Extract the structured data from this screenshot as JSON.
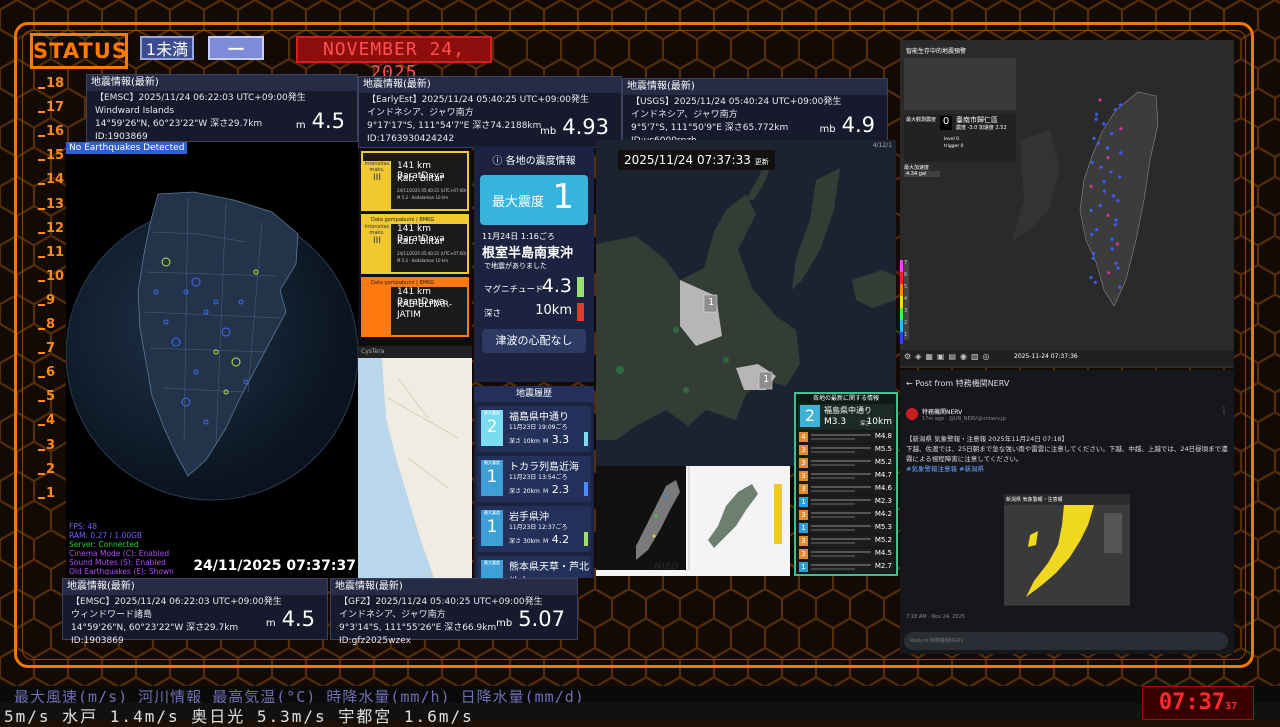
{
  "header": {
    "status_label": "STATUS",
    "intensity_pill": "1未満",
    "dash_pill": "一",
    "date_text": "NOVEMBER 24, 2025"
  },
  "scale": [
    "18",
    "17",
    "16",
    "15",
    "14",
    "13",
    "12",
    "11",
    "10",
    "9",
    "8",
    "7",
    "6",
    "5",
    "4",
    "3",
    "2",
    "1"
  ],
  "cards": {
    "emsc_top": {
      "head": "地震情報(最新)",
      "l1": "【EMSC】2025/11/24  06:22:03  UTC+09:00発生",
      "l2": "Windward Islands",
      "l3": "14°59'26\"N,  60°23'22\"W   深さ29.7km",
      "l4": "ID:1903869",
      "mtype": "m",
      "mag": "4.5"
    },
    "earlyest": {
      "head": "地震情報(最新)",
      "l1": "【EarlyEst】2025/11/24  05:40:25  UTC+09:00発生",
      "l2": "インドネシア、ジャワ南方",
      "l3": "9°17'17\"S,  111°54'7\"E   深さ74.2188km",
      "l4": "ID:1763930424242",
      "mtype": "mb",
      "mag": "4.93"
    },
    "usgs": {
      "head": "地震情報(最新)",
      "l1": "【USGS】2025/11/24  05:40:24  UTC+09:00発生",
      "l2": "インドネシア、ジャワ南方",
      "l3": "9°5'7\"S,  111°50'9\"E   深さ65.772km",
      "l4": "ID:us6000rpzh",
      "mtype": "mb",
      "mag": "4.9"
    },
    "emsc_bottom": {
      "head": "地震情報(最新)",
      "l1": "【EMSC】2025/11/24  06:22:03  UTC+09:00発生",
      "l2": "ウィンドワード諸島",
      "l3": "14°59'26\"N,  60°23'22\"W   深さ29.7km",
      "l4": "ID:1903869",
      "mtype": "m",
      "mag": "4.5"
    },
    "gfz": {
      "head": "地震情報(最新)",
      "l1": "【GFZ】2025/11/24  05:40:25  UTC+09:00発生",
      "l2": "インドネシア、ジャワ南方",
      "l3": "9°3'14\"S,  111°55'26\"E   深さ66.9km",
      "l4": "ID:gfz2025wzex",
      "mtype": "mb",
      "mag": "5.07"
    }
  },
  "globe": {
    "banner": "No Earthquakes Detected",
    "timestamp": "24/11/2025 07:37:37",
    "stats": [
      {
        "text": "FPS: 48",
        "color": "#7a5cff"
      },
      {
        "text": "RAM: 0.27 / 1.00GB",
        "color": "#7a5cff"
      },
      {
        "text": "Server: Connected",
        "color": "#27d02f"
      },
      {
        "text": "Cinema Mode (C): Enabled",
        "color": "#b04cff"
      },
      {
        "text": "Sound Mutes (S): Enabled",
        "color": "#b04cff"
      },
      {
        "text": "Old Earthquakes (E): Shown",
        "color": "#b04cff"
      }
    ]
  },
  "bmkg": [
    {
      "head": "",
      "intensity_label": "Intensitas maks.",
      "intensity": "III",
      "dist": "141 km BaratDaya",
      "place": "Kab. Blitar",
      "time": "24/11/2025 05:40:21 (UTC+07:00)",
      "mag": "M 5.2 · Kedalaman 10 km",
      "color": "#f0c830"
    },
    {
      "head": "Data gempabumi | BMKG",
      "intensity_label": "Intensitas maks.",
      "intensity": "III",
      "dist": "141 km BaratDaya",
      "place": "Kab. Blitar",
      "time": "24/11/2025 05:40:21 (UTC+07:00)",
      "mag": "M 5.2 · Kedalaman 10 km",
      "color": "#f0c830"
    },
    {
      "head": "Data gempabumi | BMKG",
      "intensity_label": "",
      "intensity": "",
      "dist": "141 km BaratDaya",
      "place": "KAB-BLITAR-JATIM",
      "time": "",
      "mag": "",
      "color": "#ff7a10"
    }
  ],
  "cystera_label": "CysTera",
  "shindo": {
    "title": "各地の震度情報",
    "max_label": "最大震度",
    "max_value": "1",
    "time": "11月24日 1:16ごろ",
    "epicenter": "根室半島南東沖",
    "occurred": "で地震がありました",
    "mag_label": "マグニチュード",
    "mag_value": "4.3",
    "depth_label": "深さ",
    "depth_value": "10km",
    "tsunami": "津波の心配なし"
  },
  "history": {
    "title": "地震履歴",
    "max_label": "最大震度",
    "items": [
      {
        "intensity": "2",
        "place": "福島県中通り",
        "time": "11月23日 19:09ごろ",
        "depth": "10km",
        "mag": "3.3",
        "bar": "#7bdcf0"
      },
      {
        "intensity": "1",
        "place": "トカラ列島近海",
        "time": "11月23日 13:54ごろ",
        "depth": "20km",
        "mag": "2.3",
        "bar": "#4f8bff"
      },
      {
        "intensity": "1",
        "place": "岩手県沖",
        "time": "11月23日 12:37ごろ",
        "depth": "30km",
        "mag": "4.2",
        "bar": "#9be070"
      },
      {
        "intensity": "",
        "place": "熊本県天草・芦北地方",
        "time": "",
        "depth": "",
        "mag": "",
        "bar": "#9be070"
      }
    ],
    "depth_label": "深さ",
    "m_label": "M"
  },
  "map": {
    "time": "2025/11/24  07:37:33",
    "suffix": "更新",
    "marker1": "1",
    "marker2": "1",
    "zoom": "4/12/1"
  },
  "nied_label": "NIED",
  "intensity_list": {
    "title": "各地の最新に関する情報",
    "head_int": "2",
    "head_place": "福島県中通り",
    "head_mag": "M3.3",
    "head_depth": "10km",
    "head_depth_label": "深さ",
    "rows": [
      {
        "i": "4",
        "c": "#e38a2c",
        "m": "M4.8"
      },
      {
        "i": "3",
        "c": "#e38a2c",
        "m": "M5.5"
      },
      {
        "i": "3",
        "c": "#e38a2c",
        "m": "M5.2"
      },
      {
        "i": "3",
        "c": "#e38a2c",
        "m": "M4.7"
      },
      {
        "i": "3",
        "c": "#e38a2c",
        "m": "M4.6"
      },
      {
        "i": "1",
        "c": "#2aa0d8",
        "m": "M2.3"
      },
      {
        "i": "3",
        "c": "#e38a2c",
        "m": "M4.2"
      },
      {
        "i": "1",
        "c": "#2aa0d8",
        "m": "M5.3"
      },
      {
        "i": "3",
        "c": "#e38a2c",
        "m": "M5.2"
      },
      {
        "i": "3",
        "c": "#e38a2c",
        "m": "M4.5"
      },
      {
        "i": "1",
        "c": "#2aa0d8",
        "m": "M2.7"
      }
    ]
  },
  "taiwan": {
    "title": "智能生存中的地震預警",
    "max_label": "最大觀測震度",
    "max_value": "0",
    "station": "臺南市歸仁區",
    "station_stats": "震度 -3.0  加速度 2.52",
    "level_label": "level",
    "trigger_label": "trigger",
    "level_value": "0",
    "trigger_value": "0",
    "pga_label": "最大加速度",
    "pga_value": "4.34 gal",
    "timestamp": "2025-11-24 07:37:36",
    "scale": [
      "7",
      "6",
      "5",
      "4",
      "3",
      "2",
      "1"
    ]
  },
  "post": {
    "back_label": "Post from 特務機関NERV",
    "author": "特務機関NERV",
    "meta": "17m ago · @UN_NERV@unnerv.jp",
    "heading": "【新潟県 気象警報・注意報 2025年11月24日 07:18】",
    "body": "下越、佐渡では、25日朝まで急な強い雨や雷雲に注意してください。下越、中越、上越では、24日昼頃まで濃霧による視程障害に注意してください。",
    "tags": "#気象警報注意報 #新潟県",
    "map_caption": "新潟県 気象警報・注意報",
    "footer_time": "7:18 AM · Nov 24, 2025",
    "reply_placeholder": "Reply to 特務機関NERV"
  },
  "ticker": {
    "row1": "最大風速(m/s)  河川情報      最高気温(°C)    時降水量(mm/h)   日降水量(mm/d)",
    "row2": "5m/s    水戸 1.4m/s      奥日光 5.3m/s      宇都宮 1.6m/s"
  },
  "clock": {
    "time": "07:37",
    "seconds": "37"
  }
}
